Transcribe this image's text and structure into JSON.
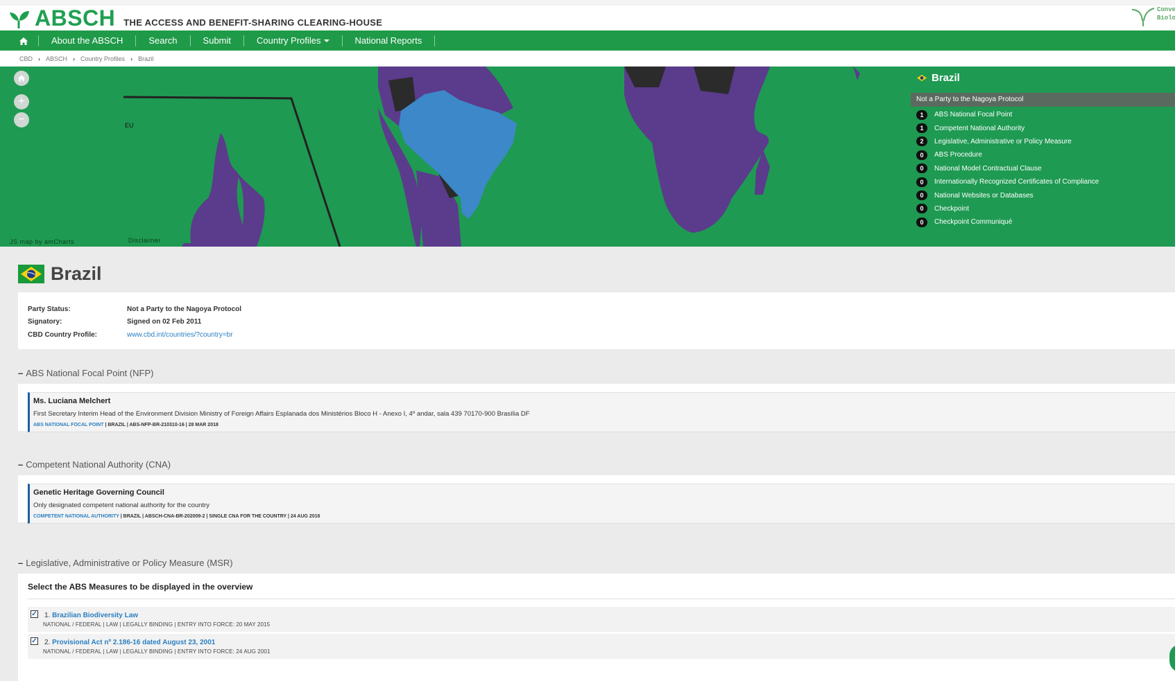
{
  "header": {
    "logo_text": "ABSCH",
    "logo_subtitle": "THE ACCESS AND BENEFIT-SHARING CLEARING-HOUSE",
    "partner_logo_text": [
      "Conve",
      "Biolog"
    ]
  },
  "nav": {
    "home_icon": "home-icon",
    "items": [
      "About the ABSCH",
      "Search",
      "Submit",
      "Country Profiles",
      "National Reports"
    ]
  },
  "breadcrumb": [
    "CBD",
    "ABSCH",
    "Country Profiles",
    "Brazil"
  ],
  "map": {
    "credit": "JS map by amCharts",
    "disclaimer": "Disclaimer",
    "region_label": "EU",
    "colors": {
      "ocean": "#1f9a52",
      "party": "#5b3b8c",
      "non_party": "#2b2b2b",
      "selected": "#3c88c8"
    },
    "panel": {
      "country": "Brazil",
      "status": "Not a Party to the Nagoya Protocol",
      "items": [
        {
          "count": "1",
          "label": "ABS National Focal Point"
        },
        {
          "count": "1",
          "label": "Competent National Authority"
        },
        {
          "count": "2",
          "label": "Legislative, Administrative or Policy Measure"
        },
        {
          "count": "0",
          "label": "ABS Procedure"
        },
        {
          "count": "0",
          "label": "National Model Contractual Clause"
        },
        {
          "count": "0",
          "label": "Internationally Recognized Certificates of Compliance"
        },
        {
          "count": "0",
          "label": "National Websites or Databases"
        },
        {
          "count": "0",
          "label": "Checkpoint"
        },
        {
          "count": "0",
          "label": "Checkpoint Communiqué"
        }
      ]
    }
  },
  "country": {
    "name": "Brazil",
    "party_status_label": "Party Status:",
    "party_status": "Not a Party to the Nagoya Protocol",
    "signatory_label": "Signatory:",
    "signatory": "Signed on 02 Feb 2011",
    "cbd_profile_label": "CBD Country Profile:",
    "cbd_profile_link": "www.cbd.int/countries/?country=br"
  },
  "sections": {
    "nfp": {
      "minus": "–",
      "title": "ABS National Focal Point (NFP)",
      "record": {
        "name": "Ms. Luciana Melchert",
        "description": "First Secretary Interim Head of the Environment Division Ministry of Foreign Affairs Esplanada dos Ministérios Bloco H - Anexo I, 4º andar, sala 439 70170-900 Brasília DF",
        "type": "ABS NATIONAL FOCAL POINT",
        "meta": " | BRAZIL | ABS-NFP-BR-210310-16 | 28 MAR 2018"
      }
    },
    "cna": {
      "minus": "–",
      "title": "Competent National Authority (CNA)",
      "record": {
        "name": "Genetic Heritage Governing Council",
        "description": "Only designated competent national authority for the country",
        "type": "COMPETENT NATIONAL AUTHORITY",
        "meta": " | BRAZIL | ABSCH-CNA-BR-202009-2 | SINGLE CNA FOR THE COUNTRY | 24 AUG 2016"
      }
    },
    "msr": {
      "minus": "–",
      "title": "Legislative, Administrative or Policy Measure (MSR)",
      "select_heading": "Select the ABS Measures to be displayed in the overview",
      "measures": [
        {
          "checked": "✓",
          "num": "1.",
          "title": "Brazilian Biodiversity Law",
          "meta": "NATIONAL / FEDERAL  |  LAW  |  LEGALLY BINDING  |  ENTRY INTO FORCE: 20 MAY 2015"
        },
        {
          "checked": "✓",
          "num": "2.",
          "title": "Provisional Act nº 2.186-16 dated August 23, 2001",
          "meta": "NATIONAL / FEDERAL  |  LAW  |  LEGALLY BINDING  |  ENTRY INTO FORCE: 24 AUG 2001"
        }
      ]
    }
  }
}
